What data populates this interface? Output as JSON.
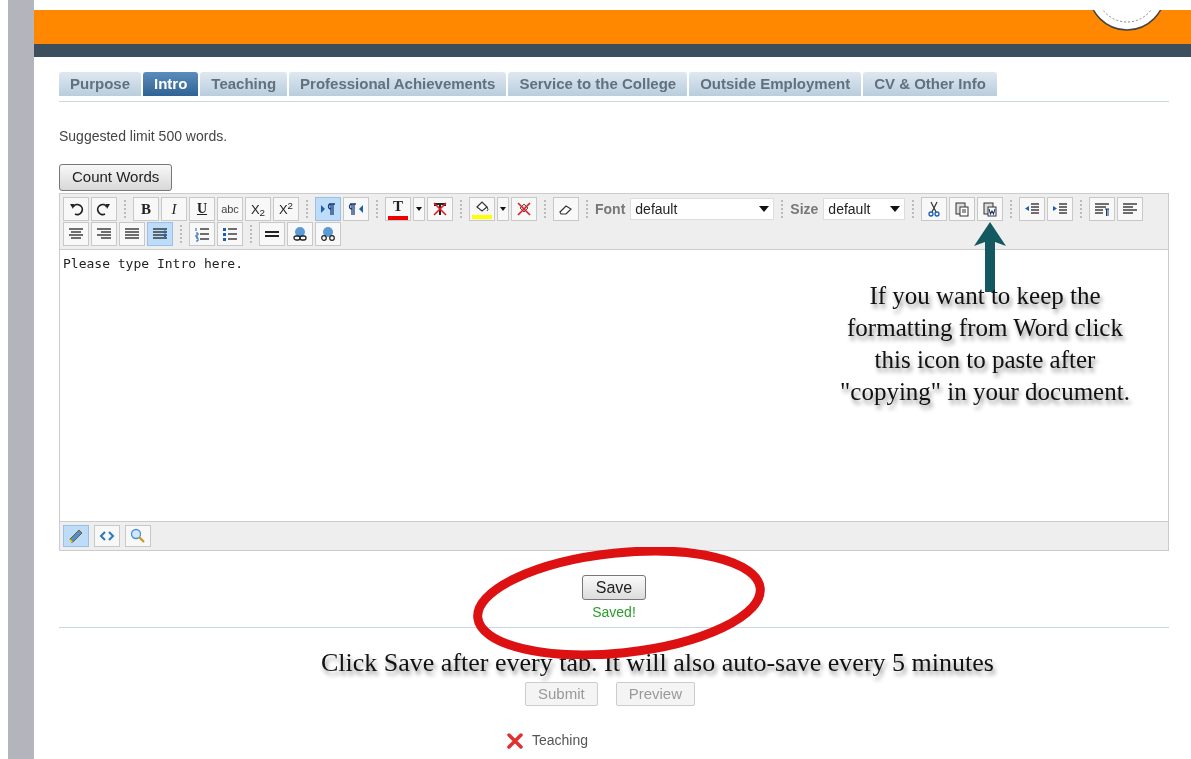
{
  "tabs": [
    {
      "label": "Purpose",
      "selected": false
    },
    {
      "label": "Intro",
      "selected": true
    },
    {
      "label": "Teaching",
      "selected": false
    },
    {
      "label": "Professional Achievements",
      "selected": false
    },
    {
      "label": "Service to the College",
      "selected": false
    },
    {
      "label": "Outside Employment",
      "selected": false
    },
    {
      "label": "CV & Other Info",
      "selected": false
    }
  ],
  "hint": "Suggested limit 500 words.",
  "count_button": "Count Words",
  "toolbar_rows": [
    [
      [
        {
          "kind": "undo",
          "selected": false
        },
        {
          "kind": "redo",
          "selected": false
        }
      ],
      [
        {
          "kind": "bold",
          "label": "B",
          "selected": false
        },
        {
          "kind": "italic",
          "label": "I",
          "selected": false
        },
        {
          "kind": "underline",
          "label": "U",
          "selected": false
        },
        {
          "kind": "strike",
          "label": "abc",
          "selected": false
        },
        {
          "kind": "sub",
          "label": "X$_{2}$",
          "selected": false
        },
        {
          "kind": "sup",
          "label": "X$^{2}$",
          "selected": false
        }
      ],
      [
        {
          "kind": "ltr",
          "selected": true
        },
        {
          "kind": "rtl",
          "selected": false
        }
      ],
      [
        {
          "kind": "text-color",
          "label": "T",
          "color": "#ee0000",
          "selected": false
        },
        {
          "kind": "caret",
          "selected": false
        },
        {
          "kind": "remove-text-color",
          "selected": false
        }
      ],
      [
        {
          "kind": "highlight",
          "color": "#ffff00",
          "selected": false
        },
        {
          "kind": "caret",
          "selected": false
        },
        {
          "kind": "remove-highlight",
          "selected": false
        }
      ],
      [
        {
          "kind": "eraser",
          "selected": false
        }
      ],
      [
        {
          "kind": "select",
          "label": "Font",
          "value": "default"
        }
      ],
      [
        {
          "kind": "select",
          "label": "Size",
          "value": "default"
        }
      ],
      [
        {
          "kind": "cut",
          "selected": false
        },
        {
          "kind": "paste",
          "selected": false
        },
        {
          "kind": "paste-word",
          "selected": false
        }
      ],
      [
        {
          "kind": "outdent",
          "selected": false
        },
        {
          "kind": "indent",
          "selected": false
        }
      ],
      [
        {
          "kind": "paragraph",
          "selected": false
        },
        {
          "kind": "align-left",
          "selected": false
        }
      ]
    ],
    [
      [
        {
          "kind": "align-center",
          "selected": false
        },
        {
          "kind": "align-right",
          "selected": false
        },
        {
          "kind": "align-justify",
          "selected": false
        },
        {
          "kind": "align-full",
          "selected": true
        }
      ],
      [
        {
          "kind": "ordered-list",
          "selected": false
        },
        {
          "kind": "bullet-list",
          "selected": false
        }
      ],
      [
        {
          "kind": "rule",
          "selected": false
        },
        {
          "kind": "link",
          "selected": false
        },
        {
          "kind": "unlink",
          "selected": false
        }
      ]
    ]
  ],
  "editor_text": "Please type Intro here.",
  "mode_buttons": [
    {
      "kind": "design",
      "selected": true
    },
    {
      "kind": "code",
      "selected": false
    },
    {
      "kind": "preview",
      "selected": false
    }
  ],
  "paste_note": "If you want to keep the formatting from Word click this icon to paste after \"copying\" in your document.",
  "save_button": "Save",
  "save_status": "Saved!",
  "save_note": "Click Save after every tab. It will also auto-save every 5 minutes",
  "action_buttons": [
    {
      "label": "Submit",
      "disabled": true
    },
    {
      "label": "Preview",
      "disabled": true
    }
  ],
  "errors": [
    {
      "label": "Teaching"
    }
  ]
}
